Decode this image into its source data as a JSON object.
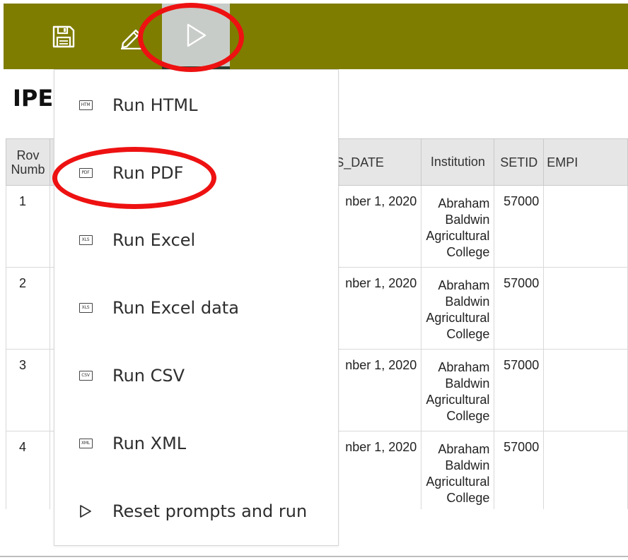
{
  "toolbar": {
    "save_icon": "save-icon",
    "edit_icon": "pencil-icon",
    "run_icon": "play-icon"
  },
  "page": {
    "title_partial": "IPE"
  },
  "table": {
    "headers": {
      "row_number": [
        "Rov",
        "Numb"
      ],
      "census_date": "NSUS_DATE",
      "institution": "Institution",
      "setid": "SETID",
      "empl": "EMPI"
    },
    "rows": [
      {
        "row": "1",
        "date": "nber 1, 2020",
        "institution": [
          "Abraham",
          "Baldwin",
          "Agricultural",
          "College"
        ],
        "setid": "57000"
      },
      {
        "row": "2",
        "date": "nber 1, 2020",
        "institution": [
          "Abraham",
          "Baldwin",
          "Agricultural",
          "College"
        ],
        "setid": "57000"
      },
      {
        "row": "3",
        "date": "nber 1, 2020",
        "institution": [
          "Abraham",
          "Baldwin",
          "Agricultural",
          "College"
        ],
        "setid": "57000"
      },
      {
        "row": "4",
        "date": "nber 1, 2020",
        "institution": [
          "Abraham",
          "Baldwin",
          "Agricultural",
          "College"
        ],
        "setid": "57000"
      }
    ]
  },
  "menu": {
    "items": [
      {
        "label": "Run HTML",
        "icon_text": "HTM",
        "icon": "html-file-icon"
      },
      {
        "label": "Run PDF",
        "icon_text": "PDF",
        "icon": "pdf-file-icon"
      },
      {
        "label": "Run Excel",
        "icon_text": "XLS",
        "icon": "xls-file-icon"
      },
      {
        "label": "Run Excel data",
        "icon_text": "XLS",
        "icon": "xls-file-icon"
      },
      {
        "label": "Run CSV",
        "icon_text": "CSV",
        "icon": "csv-file-icon"
      },
      {
        "label": "Run XML",
        "icon_text": "XML",
        "icon": "xml-file-icon"
      },
      {
        "label": "Reset prompts and run",
        "icon": "play-icon"
      }
    ]
  },
  "colors": {
    "toolbar_bg": "#7f7d00",
    "run_button_active_bg": "#c8ccc8",
    "annotation_red": "#ee1111"
  }
}
